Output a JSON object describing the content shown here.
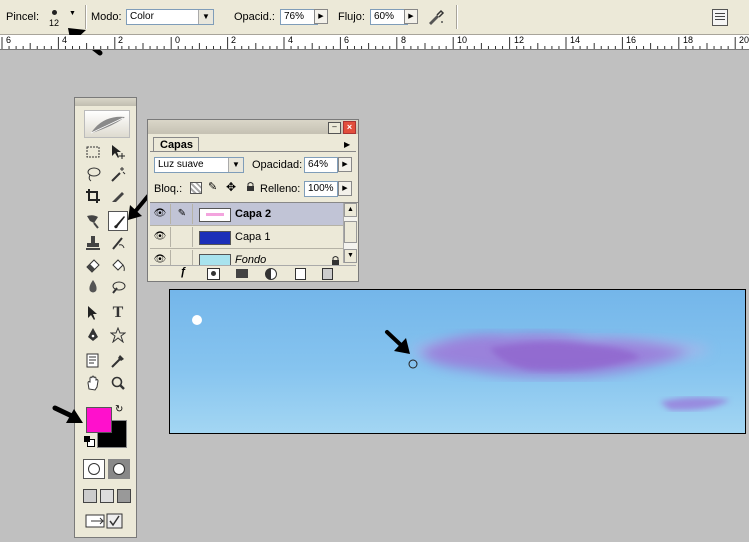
{
  "options_bar": {
    "brush_label": "Pincel:",
    "brush_size": "12",
    "mode_label": "Modo:",
    "mode_value": "Color",
    "opacity_label": "Opacid.:",
    "opacity_value": "76%",
    "flow_label": "Flujo:",
    "flow_value": "60%"
  },
  "ruler": {
    "labels": [
      "6",
      "4",
      "2",
      "0",
      "2",
      "4",
      "6",
      "8",
      "10",
      "12",
      "14",
      "16",
      "18",
      "20"
    ]
  },
  "toolbox": {
    "foreground_color": "#ff10cc",
    "background_color": "#000000"
  },
  "layers_panel": {
    "tab_label": "Capas",
    "blend_mode": "Luz suave",
    "opacity_label": "Opacidad:",
    "opacity_value": "64%",
    "lock_label": "Bloq.:",
    "fill_label": "Relleno:",
    "fill_value": "100%",
    "layers": [
      {
        "name": "Capa 2",
        "selected": true
      },
      {
        "name": "Capa 1",
        "selected": false
      },
      {
        "name": "Fondo",
        "selected": false
      }
    ]
  },
  "colors": {
    "selected_layer": "#c1c4d6",
    "layer1_thumb": "#1c2fb8",
    "sky_top": "#74b6ea",
    "cloud": "#a77ad8"
  }
}
